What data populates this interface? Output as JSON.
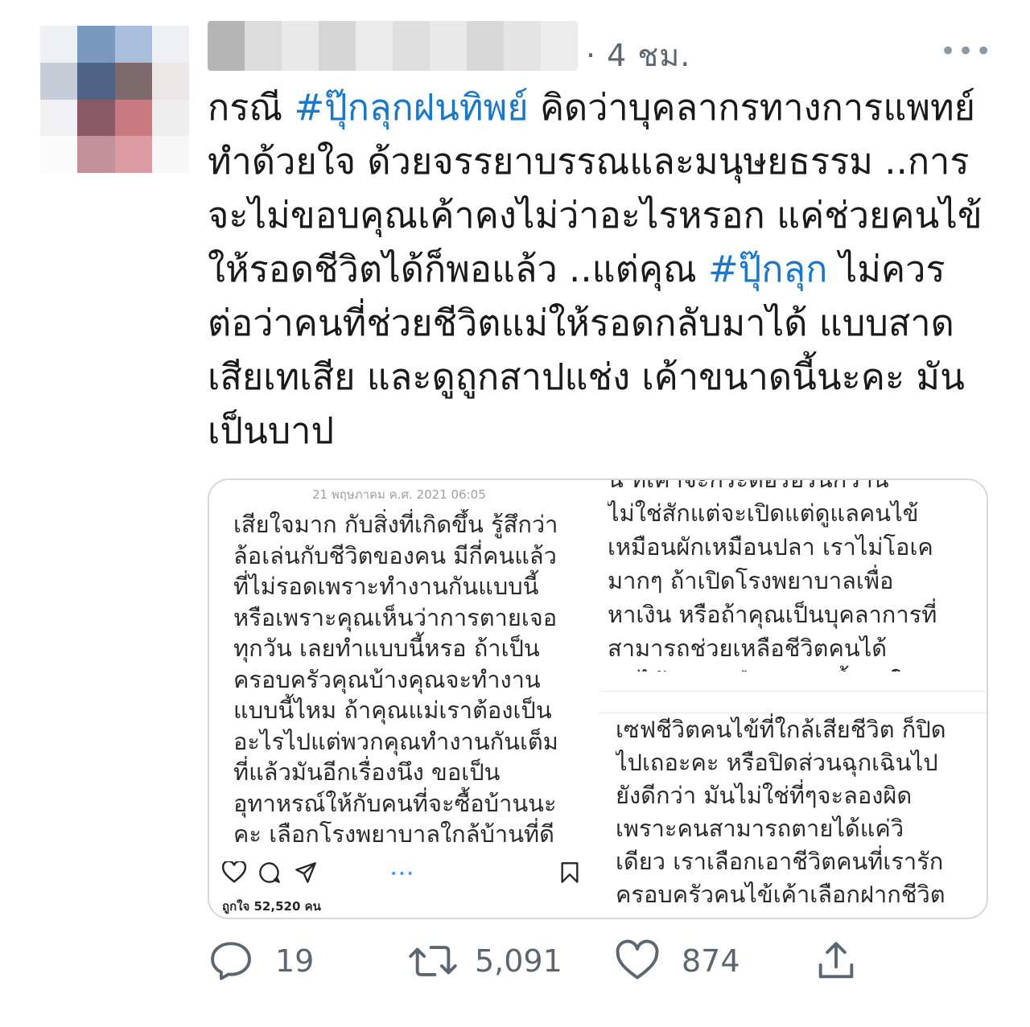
{
  "tweet": {
    "timestamp": "· 4 ชม.",
    "more_label": "•••",
    "text_parts": [
      {
        "text": "กรณี ",
        "hashtag": false
      },
      {
        "text": "#ปุ๊กลุกฝนทิพย์",
        "hashtag": true
      },
      {
        "text": " คิดว่าบุคลากรทางการแพทย์ ทำด้วยใจ ด้วยจรรยาบรรณและมนุษยธรรม ..การจะไม่ขอบคุณเค้าคงไม่ว่าอะไรหรอก แค่ช่วยคนไข้ให้รอดชีวิตได้ก็พอแล้ว ..แต่คุณ ",
        "hashtag": false
      },
      {
        "text": "#ปุ๊กลุก",
        "hashtag": true
      },
      {
        "text": " ไม่ควรต่อว่าคนที่ช่วยชีวิตแม่ให้รอดกลับมาได้ แบบสาดเสียเทเสีย และดูถูกสาปแช่ง เค้าขนาดนี้นะคะ มันเป็นบาป",
        "hashtag": false
      }
    ],
    "colors": {
      "hashtag": "#1d77c7",
      "meta_text": "#5b6670"
    }
  },
  "media": {
    "left_shot": {
      "date": "21 พฤษภาคม ค.ศ. 2021 06:05",
      "body": "เสียใจมาก กับสิ่งที่เกิดขึ้น รู้สึกว่า\nล้อเล่นกับชีวิตของคน มีกี่คนแล้ว\nที่ไม่รอดเพราะทำงานกันแบบนี้\nหรือเพราะคุณเห็นว่าการตายเจอ\nทุกวัน เลยทำแบบนี้หรอ ถ้าเป็น\nครอบครัวคุณบ้างคุณจะทำงาน\nแบบนี้ไหม ถ้าคุณแม่เราต้องเป็น\nอะไรไปแต่พวกคุณทำงานกันเต็ม\nที่แล้วมันอีกเรื่องนึง ขอเป็น\nอุทาหรณ์ให้กับคนที่จะซื้อบ้านนะ\nคะ เลือกโรงพยาบาลใกล้บ้านที่ดี",
      "likes": "ถูกใจ 52,520 คน",
      "icons": [
        "heart-outline-icon",
        "comment-icon",
        "share-icon",
        "bookmark-icon"
      ]
    },
    "right_shot": {
      "top_text": "น ที่เค้าจะกระตือรือร้นกว่านี้\nไม่ใช่สักแต่จะเปิดแต่ดูแลคนไข้\nเหมือนผักเหมือนปลา เราไม่โอเค\nมากๆ ถ้าเปิดโรงพยาบาลเพื่อ\nหาเงิน หรือถ้าคุณเป็นบุคลาการที่\nสามารถช่วยเหลือชีวิตคนได้\nคนไข้จะอยู่หรือจะตายขึ้นอยู่ใน",
      "bottom_text": "เซฟชีวิตคนไข้ที่ใกล้เสียชีวิต ก็ปิด\nไปเถอะคะ หรือปิดส่วนฉุกเฉินไป\nยังดีกว่า มันไม่ใช่ที่ๆจะลองผิด\nเพราะคนสามารถตายได้แค่วิ\nเดียว เราเลือกเอาชีวิตคนที่เรารัก\nครอบครัวคนไข้เค้าเลือกฝากชีวิต"
    }
  },
  "actions": {
    "reply_count": "19",
    "retweet_count": "5,091",
    "like_count": "874",
    "icons": [
      "reply-icon",
      "retweet-icon",
      "like-icon",
      "share-icon"
    ]
  },
  "avatar_colors": [
    "#eef0f3",
    "#7a98c0",
    "#a9bedb",
    "#eef0f3",
    "#c7cdd6",
    "#4e6283",
    "#7e6a6c",
    "#ebe7e6",
    "#f1f1f3",
    "#8a5966",
    "#c97a80",
    "#eeeeef",
    "#fbfbfc",
    "#c2919b",
    "#dd9ba3",
    "#f7f7f8"
  ],
  "name_blur_colors": [
    "#b5b5b5",
    "#dcdcdc",
    "#e8e8e8",
    "#d5d5d5",
    "#ebebeb",
    "#dedede",
    "#e9e9e9",
    "#d8d8d8",
    "#e4e4e4",
    "#ececec"
  ]
}
